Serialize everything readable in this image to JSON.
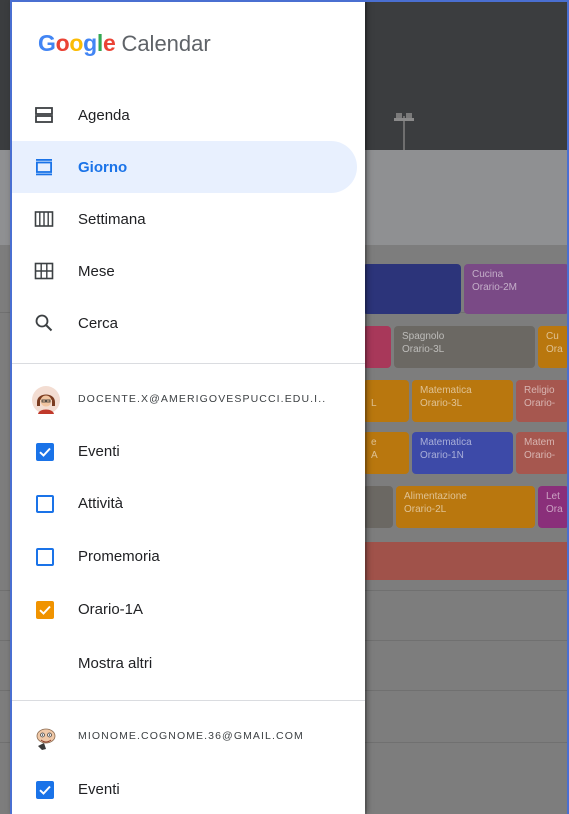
{
  "app": {
    "logo_letters": [
      "G",
      "o",
      "o",
      "g",
      "l",
      "e"
    ],
    "logo_colors": [
      "#4285F4",
      "#EA4335",
      "#FBBC05",
      "#4285F4",
      "#34A853",
      "#EA4335"
    ],
    "product": "Calendar"
  },
  "views": [
    {
      "label": "Agenda",
      "icon": "agenda-icon"
    },
    {
      "label": "Giorno",
      "icon": "day-icon",
      "active": true
    },
    {
      "label": "Settimana",
      "icon": "week-icon"
    },
    {
      "label": "Mese",
      "icon": "month-icon"
    },
    {
      "label": "Cerca",
      "icon": "search-icon"
    }
  ],
  "account1": {
    "email": "DOCENTE.X@AMERIGOVESPUCCI.EDU.I..",
    "calendars": [
      {
        "label": "Eventi",
        "checked": true,
        "color": "#1a73e8"
      },
      {
        "label": "Attività",
        "checked": false,
        "color": "#1a73e8"
      },
      {
        "label": "Promemoria",
        "checked": false,
        "color": "#1a73e8"
      },
      {
        "label": "Orario-1A",
        "checked": true,
        "color": "#f09300"
      }
    ],
    "more_label": "Mostra altri"
  },
  "account2": {
    "email": "MIONOME.COGNOME.36@GMAIL.COM",
    "calendars": [
      {
        "label": "Eventi",
        "checked": true,
        "color": "#1a73e8"
      }
    ]
  },
  "background_events": [
    {
      "title": "Cucina",
      "sub": "Orario-2M",
      "color": "#7a4a86"
    },
    {
      "title": "Spagnolo",
      "sub": "Orario-3L",
      "color": "#6b6863"
    },
    {
      "title": "Cu",
      "sub": "Ora",
      "color": "#b9770e"
    },
    {
      "title": "Matematica",
      "sub": "Orario-3L",
      "color": "#b9770e"
    },
    {
      "title": "Religio",
      "sub": "Orario-",
      "color": "#a6574f"
    },
    {
      "title": "Matematica",
      "sub": "Orario-1N",
      "color": "#3d4aa8"
    },
    {
      "title": "Matem",
      "sub": "Orario-",
      "color": "#a6574f"
    },
    {
      "title": "Alimentazione",
      "sub": "Orario-2L",
      "color": "#b9770e"
    },
    {
      "title": "Let",
      "sub": "Ora",
      "color": "#8a2f7a"
    },
    {
      "title": "L",
      "sub": "",
      "color": "#b9770e"
    },
    {
      "title": "e",
      "sub": "A",
      "color": "#b9770e"
    }
  ]
}
